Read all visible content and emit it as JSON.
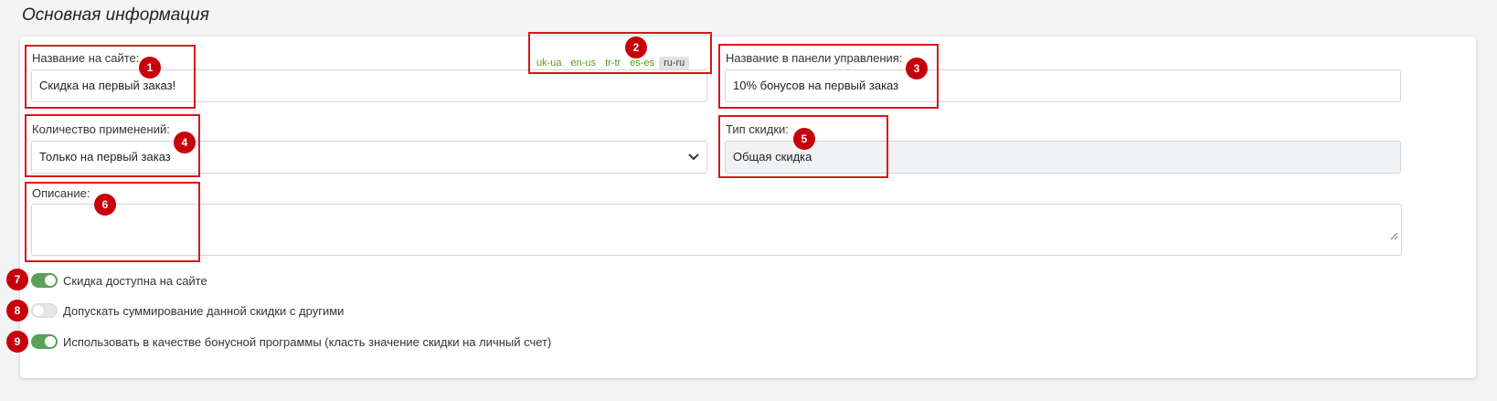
{
  "page": {
    "title": "Основная информация"
  },
  "form": {
    "site_name": {
      "label": "Название на сайте:",
      "value": "Скидка на первый заказ!"
    },
    "admin_name": {
      "label": "Название в панели управления:",
      "value": "10% бонусов на первый заказ"
    },
    "usage_count": {
      "label": "Количество применений:",
      "selected": "Только на первый заказ"
    },
    "discount_type": {
      "label": "Тип скидки:",
      "value": "Общая скидка"
    },
    "description": {
      "label": "Описание:",
      "value": ""
    }
  },
  "languages": {
    "tabs": [
      "uk-ua",
      "en-us",
      "tr-tr",
      "es-es",
      "ru-ru"
    ],
    "active": "ru-ru"
  },
  "toggles": [
    {
      "label": "Скидка доступна на сайте",
      "on": true
    },
    {
      "label": "Допускать суммирование данной скидки с другими",
      "on": false
    },
    {
      "label": "Использовать в качестве бонусной программы (класть значение скидки на личный счет)",
      "on": true
    }
  ],
  "annotations": [
    "1",
    "2",
    "3",
    "4",
    "5",
    "6",
    "7",
    "8",
    "9"
  ],
  "colors": {
    "annotation": "#d8161e",
    "badge": "#c8000a",
    "toggle_on": "#5aa05a",
    "lang_tab": "#5a9a1a"
  }
}
